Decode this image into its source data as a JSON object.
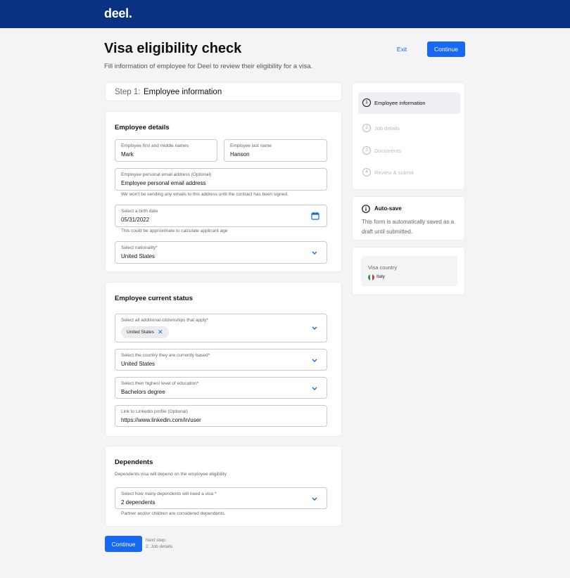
{
  "header": {
    "logo": "deel."
  },
  "page": {
    "title": "Visa eligibility check",
    "subtitle": "Fill information of employee for Deel to review their eligibility for a visa.",
    "exit_label": "Exit",
    "continue_label": "Continue"
  },
  "step_header": {
    "number": "Step 1:",
    "name": "Employee information"
  },
  "employee_details": {
    "title": "Employee details",
    "first_name": {
      "label": "Employee first and middle names",
      "value": "Mark"
    },
    "last_name": {
      "label": "Employee last name",
      "value": "Hanson"
    },
    "email": {
      "label": "Employee personal email address (Optional)",
      "value": "Employee personal email address",
      "helper": "We won't be sending any emails to this address until the contract has been signed."
    },
    "birth_date": {
      "label": "Select a birth date",
      "value": "05/31/2022",
      "helper": "This could be approximate to calculate applicant age"
    },
    "nationality": {
      "label": "Select nationality*",
      "value": "United States"
    }
  },
  "current_status": {
    "title": "Employee current status",
    "citizenships": {
      "label": "Select all additional citizenships that apply*",
      "chip": "United States",
      "chip_remove": "✕"
    },
    "based_country": {
      "label": "Select the country they are currently based*",
      "value": "United States"
    },
    "education": {
      "label": "Select their highest level of education*",
      "value": "Bachelors degree"
    },
    "linkedin": {
      "label": "Link to Linkedin profile (Optional)",
      "value": "https://www.linkedin.com/in/user"
    }
  },
  "dependents": {
    "title": "Dependents",
    "description": "Dependents visa will depend on the employee eligibility",
    "count": {
      "label": "Select how many dependents will need a visa *",
      "value": "2 dependents",
      "helper": "Partner and/or children are considered dependents."
    }
  },
  "sidebar": {
    "steps": [
      {
        "num": "1",
        "label": "Employee information",
        "active": true
      },
      {
        "num": "2",
        "label": "Job details",
        "active": false
      },
      {
        "num": "3",
        "label": "Documents",
        "active": false
      },
      {
        "num": "4",
        "label": "Review & submit",
        "active": false
      }
    ],
    "autosave": {
      "title": "Auto-save",
      "text": "This form is automatically saved as a draft until submitted."
    },
    "visa": {
      "label": "Visa country",
      "country": "Italy"
    }
  },
  "footer": {
    "continue_label": "Continue",
    "next_label": "Next step:",
    "next_step": "2. Job details"
  },
  "colors": {
    "topbar": "#0a3283",
    "accent": "#1768f2"
  }
}
